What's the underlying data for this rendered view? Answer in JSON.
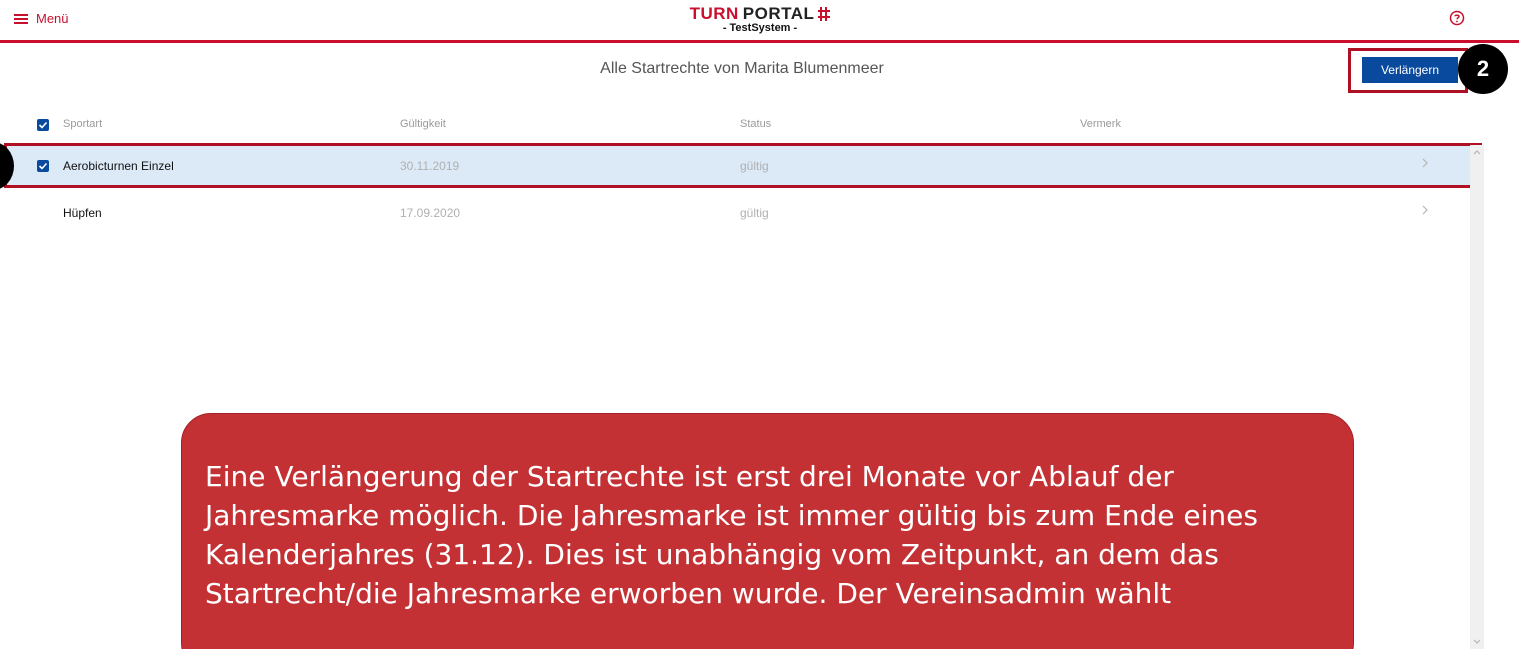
{
  "header": {
    "menu_label": "Menü",
    "logo_turn": "TURN",
    "logo_portal": "PORTAL",
    "logo_sub": "- TestSystem -"
  },
  "page": {
    "title": "Alle Startrechte von Marita Blumenmeer",
    "extend_button": "Verlängern"
  },
  "callouts": {
    "two": "2"
  },
  "table": {
    "columns": [
      "Sportart",
      "Gültigkeit",
      "Status",
      "Vermerk"
    ],
    "rows": [
      {
        "name": "Aerobicturnen Einzel",
        "date": "30.11.2019",
        "status": "gültig",
        "note": "",
        "selected": true
      },
      {
        "name": "Hüpfen",
        "date": "17.09.2020",
        "status": "gültig",
        "note": "",
        "selected": false
      }
    ]
  },
  "info": {
    "text": "Eine Verlängerung der Startrechte ist erst drei Monate vor Ablauf der Jahresmarke möglich. Die Jahresmarke ist immer gültig bis zum Ende eines Kalenderjahres (31.12). Dies ist unabhängig vom Zeitpunkt, an dem das Startrecht/die Jahresmarke erworben wurde. Der Vereinsadmin wählt"
  },
  "colors": {
    "brand_red": "#c8102e",
    "primary_blue": "#0a4a9e",
    "selected_row": "#dce9f7",
    "info_bg": "#c33134"
  }
}
